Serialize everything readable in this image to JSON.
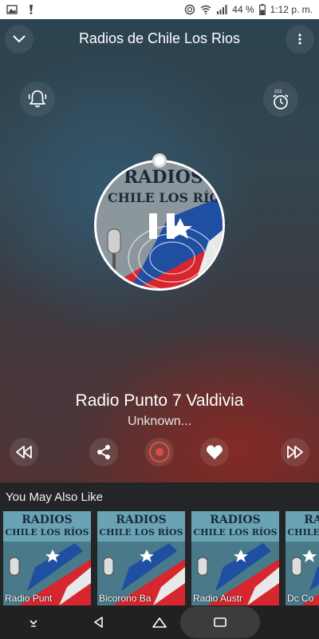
{
  "status_bar": {
    "battery": "44 %",
    "time": "1:12 p. m."
  },
  "header": {
    "title": "Radios de Chile Los Rios"
  },
  "artwork": {
    "line1": "RADIOS",
    "line2": "CHILE LOS RÍOS"
  },
  "now_playing": {
    "station": "Radio Punto 7 Valdivia",
    "track": "Unknown..."
  },
  "colors": {
    "accent": "#e04a3f",
    "flag_red": "#d7262e",
    "flag_blue": "#1f4fa0",
    "panel": "#232527"
  },
  "icons": {
    "collapse": "chevron-down-icon",
    "menu": "more-vert-icon",
    "alarm": "alarm-bell-icon",
    "sleep": "sleep-timer-icon",
    "rewind": "rewind-icon",
    "share": "share-icon",
    "record": "record-icon",
    "favorite": "heart-icon",
    "forward": "fast-forward-icon"
  },
  "recommendations": {
    "title": "You May Also Like",
    "items": [
      {
        "name": "Radio Punt",
        "art_line1": "RADIOS",
        "art_line2": "CHILE LOS RÍOS"
      },
      {
        "name": "Bicorono Ba",
        "art_line1": "RADIOS",
        "art_line2": "CHILE LOS RÍOS"
      },
      {
        "name": "Radio Austr",
        "art_line1": "RADIOS",
        "art_line2": "CHILE LOS RÍOS"
      },
      {
        "name": "Dc Co",
        "art_line1": "RADIOS",
        "art_line2": "CHILE LOS RÍOS"
      }
    ]
  }
}
